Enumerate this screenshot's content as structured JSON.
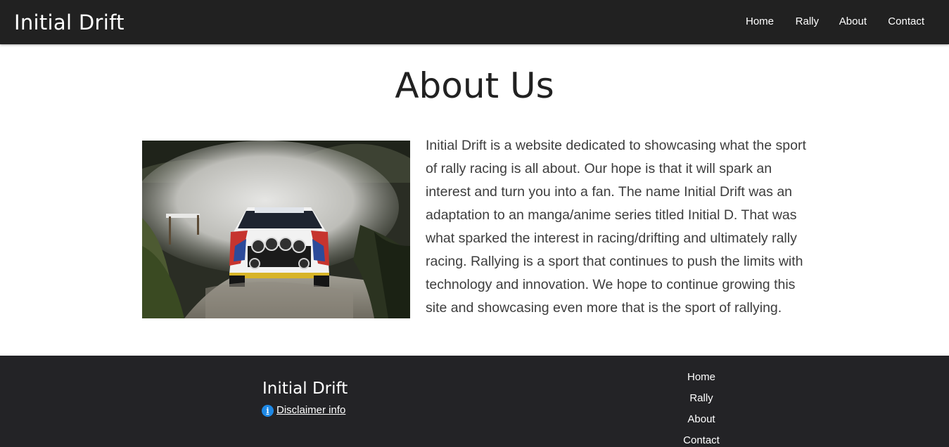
{
  "navbar": {
    "brand": "Initial Drift",
    "links": [
      {
        "label": "Home"
      },
      {
        "label": "Rally"
      },
      {
        "label": "About"
      },
      {
        "label": "Contact"
      }
    ]
  },
  "main": {
    "title": "About Us",
    "image": {
      "icon": "rally-car-photo"
    },
    "paragraph": "Initial Drift is a website dedicated to showcasing what the sport of rally racing is all about. Our hope is that it will spark an interest and turn you into a fan. The name Initial Drift was an adaptation to an manga/anime series titled Initial D. That was what sparked the interest in racing/drifting and ultimately rally racing. Rallying is a sport that continues to push the limits with technology and innovation. We hope to continue growing this site and showcasing even more that is the sport of rallying."
  },
  "footer": {
    "brand": "Initial Drift",
    "disclaimer_icon": "info-icon",
    "disclaimer_label": "Disclaimer info",
    "links": [
      {
        "label": "Home"
      },
      {
        "label": "Rally"
      },
      {
        "label": "About"
      },
      {
        "label": "Contact"
      }
    ]
  },
  "colors": {
    "navbar_bg": "#212121",
    "footer_bg": "#232326",
    "info_icon": "#1e88e5"
  }
}
